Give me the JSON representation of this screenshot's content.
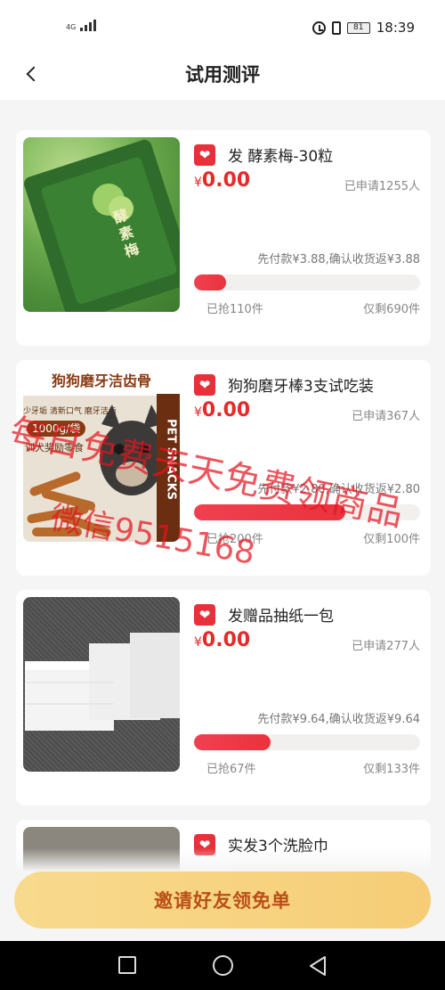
{
  "status_bar": {
    "network": "4G",
    "battery": "81",
    "time": "18:39"
  },
  "header": {
    "title": "试用测评"
  },
  "items": [
    {
      "name": "发 酵素梅-30粒",
      "currency": "¥",
      "price": "0.00",
      "applied": "已申请1255人",
      "pay_info": "先付款¥3.88,确认收货返¥3.88",
      "progress": 0.14,
      "robbed": "已抢110件",
      "remaining": "仅剩690件",
      "image_text": "酵素梅"
    },
    {
      "name": "狗狗磨牙棒3支试吃装",
      "currency": "¥",
      "price": "0.00",
      "applied": "已申请367人",
      "pay_info": "先付款¥2.80,确认收货返¥2.80",
      "progress": 0.67,
      "robbed": "已抢200件",
      "remaining": "仅剩100件",
      "image_title": "狗狗磨牙洁齿骨",
      "image_sub": "少牙垢 清新口气 磨牙洁齿",
      "image_weight": "1000g/袋",
      "image_reward": "训犬奖励零食",
      "image_brand": "PET SNACKS"
    },
    {
      "name": "发赠品抽纸一包",
      "currency": "¥",
      "price": "0.00",
      "applied": "已申请277人",
      "pay_info": "先付款¥9.64,确认收货返¥9.64",
      "progress": 0.34,
      "robbed": "已抢67件",
      "remaining": "仅剩133件"
    },
    {
      "name": "实发3个洗脸巾"
    }
  ],
  "watermark": {
    "line1": "每日免费天天免费领商品",
    "line2": "微信9515168"
  },
  "invite_button": {
    "label": "邀请好友领免单"
  },
  "colors": {
    "accent_red": "#e62a2a",
    "button_gold": "#f6cd76",
    "button_text": "#b94f18"
  }
}
